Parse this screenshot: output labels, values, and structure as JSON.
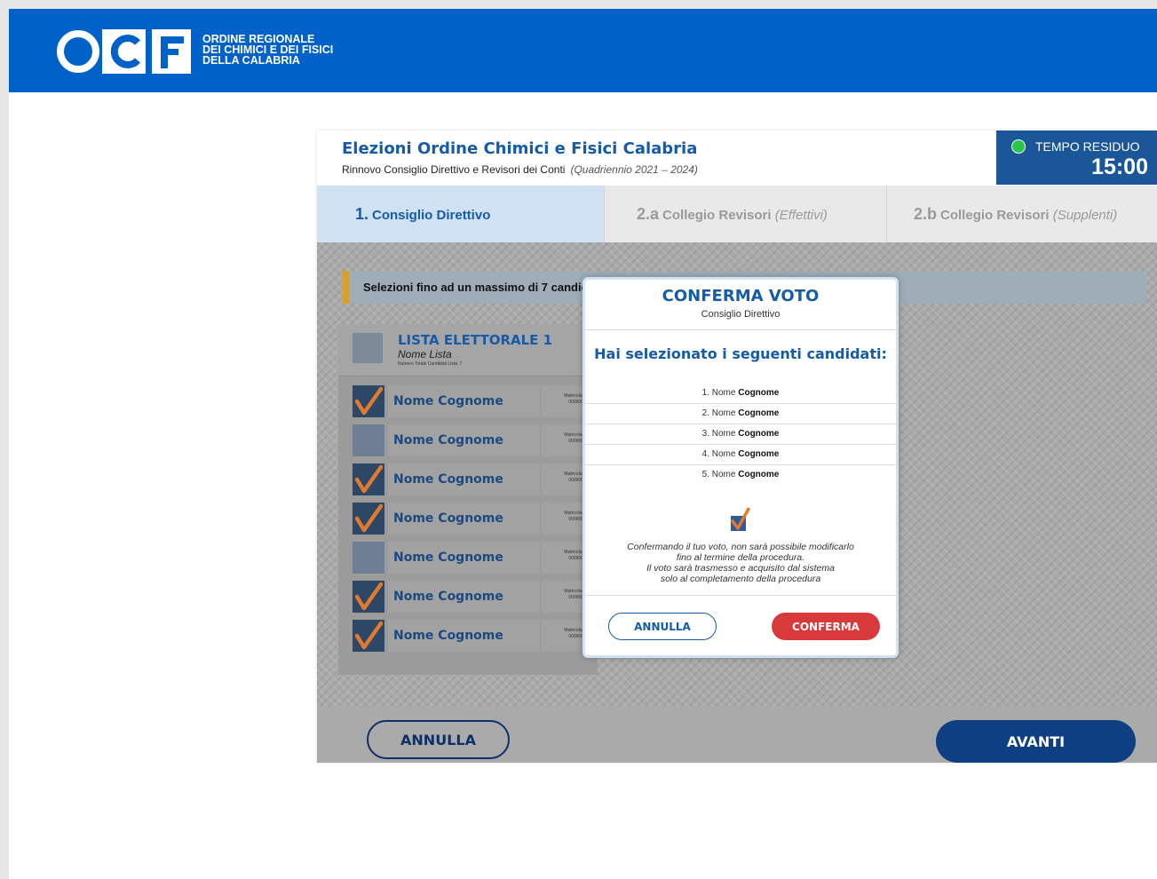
{
  "header": {
    "logo_text": "OCF",
    "org_name": "ORDINE REGIONALE\nDEI CHIMICI E DEI FISICI\nDELLA CALABRIA"
  },
  "election": {
    "title": "Elezioni Ordine Chimici e Fisici Calabria",
    "subtitle": "Rinnovo Consiglio Direttivo e Revisori dei Conti",
    "period": "(Quadriennio 2021 – 2024)"
  },
  "timer": {
    "label": "TEMPO RESIDUO",
    "value": "15:00"
  },
  "steps": [
    {
      "num": "1.",
      "label": "Consiglio Direttivo",
      "sub": "",
      "active": true
    },
    {
      "num": "2.a",
      "label": "Collegio Revisori",
      "sub": "(Effettivi)",
      "active": false
    },
    {
      "num": "2.b",
      "label": "Collegio Revisori",
      "sub": "(Supplenti)",
      "active": false
    }
  ],
  "notice": "Selezioni fino ad un massimo di 7 candidati",
  "lista": {
    "title": "LISTA ELETTORALE 1",
    "name": "Nome Lista",
    "count": "Numero Totale Candidati Lista: 7",
    "candidates": [
      {
        "name": "Nome Cognome",
        "matricola_label": "Matricola:",
        "matricola": "000000",
        "checked": true
      },
      {
        "name": "Nome Cognome",
        "matricola_label": "Matricola:",
        "matricola": "000000",
        "checked": false
      },
      {
        "name": "Nome Cognome",
        "matricola_label": "Matricola:",
        "matricola": "000000",
        "checked": true
      },
      {
        "name": "Nome Cognome",
        "matricola_label": "Matricola:",
        "matricola": "000000",
        "checked": true
      },
      {
        "name": "Nome Cognome",
        "matricola_label": "Matricola:",
        "matricola": "000000",
        "checked": false
      },
      {
        "name": "Nome Cognome",
        "matricola_label": "Matricola:",
        "matricola": "000000",
        "checked": true
      },
      {
        "name": "Nome Cognome",
        "matricola_label": "Matricola:",
        "matricola": "000000",
        "checked": true
      }
    ]
  },
  "footer": {
    "annulla": "ANNULLA",
    "avanti": "AVANTI"
  },
  "modal": {
    "title": "CONFERMA VOTO",
    "subtitle": "Consiglio Direttivo",
    "heading": "Hai selezionato i seguenti candidati:",
    "selected": [
      {
        "num": "1.",
        "first": "Nome",
        "last": "Cognome"
      },
      {
        "num": "2.",
        "first": "Nome",
        "last": "Cognome"
      },
      {
        "num": "3.",
        "first": "Nome",
        "last": "Cognome"
      },
      {
        "num": "4.",
        "first": "Nome",
        "last": "Cognome"
      },
      {
        "num": "5.",
        "first": "Nome",
        "last": "Cognome"
      }
    ],
    "note": "Confermando il tuo voto, non sarà possibile modificarlo\nfino al termine della procedura.\nIl voto sarà trasmesso e acquisito dal sistema\nsolo al completamento della procedura",
    "annulla": "ANNULLA",
    "conferma": "CONFERMA"
  },
  "colors": {
    "brand_blue": "#0062c8",
    "title_blue": "#155ba8",
    "timer_bg": "#1a5698",
    "timer_dot": "#2bc34d",
    "check_orange": "#e07a2c",
    "confirm_red": "#d8393b"
  },
  "icons": {
    "timer": "status-dot-icon",
    "checkbox": "checkmark-icon"
  }
}
